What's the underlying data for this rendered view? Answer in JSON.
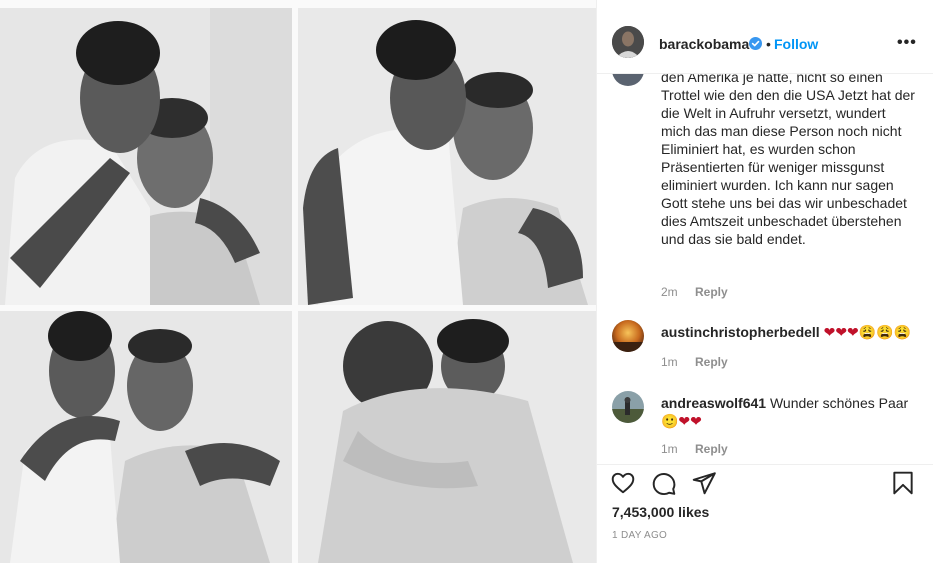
{
  "post": {
    "author": "barackobama",
    "verified_icon": "verified-badge-icon",
    "separator": "•",
    "follow_label": "Follow",
    "more_label": "•••",
    "photos": [
      {
        "name": "photo-top-left"
      },
      {
        "name": "photo-top-right"
      },
      {
        "name": "photo-bottom-left"
      },
      {
        "name": "photo-bottom-right"
      }
    ]
  },
  "comments": [
    {
      "user": "",
      "text": "den Amerika je hatte, nicht so einen Trottel wie den den die USA Jetzt hat der die Welt in Aufruhr versetzt, wundert mich das man diese Person noch nicht Eliminiert hat, es wurden schon Präsentierten für weniger missgunst eliminiert wurden. Ich kann nur sagen Gott stehe uns bei das wir unbeschadet dies Amtszeit unbeschadet überstehen und das sie bald endet.",
      "time": "2m",
      "reply": "Reply"
    },
    {
      "user": "austinchristopherbedell",
      "text": "❤❤❤😩😩😩",
      "time": "1m",
      "reply": "Reply"
    },
    {
      "user": "andreaswolf641",
      "text": "Wunder schönes Paar",
      "text2": "🙂❤❤",
      "time": "1m",
      "reply": "Reply"
    }
  ],
  "actions": {
    "likes": "7,453,000 likes",
    "time_ago": "1 DAY AGO"
  },
  "colors": {
    "accent": "#0095f6",
    "text": "#262626",
    "muted": "#8e8e8e",
    "border": "#efefef",
    "heart": "#c0112a"
  }
}
